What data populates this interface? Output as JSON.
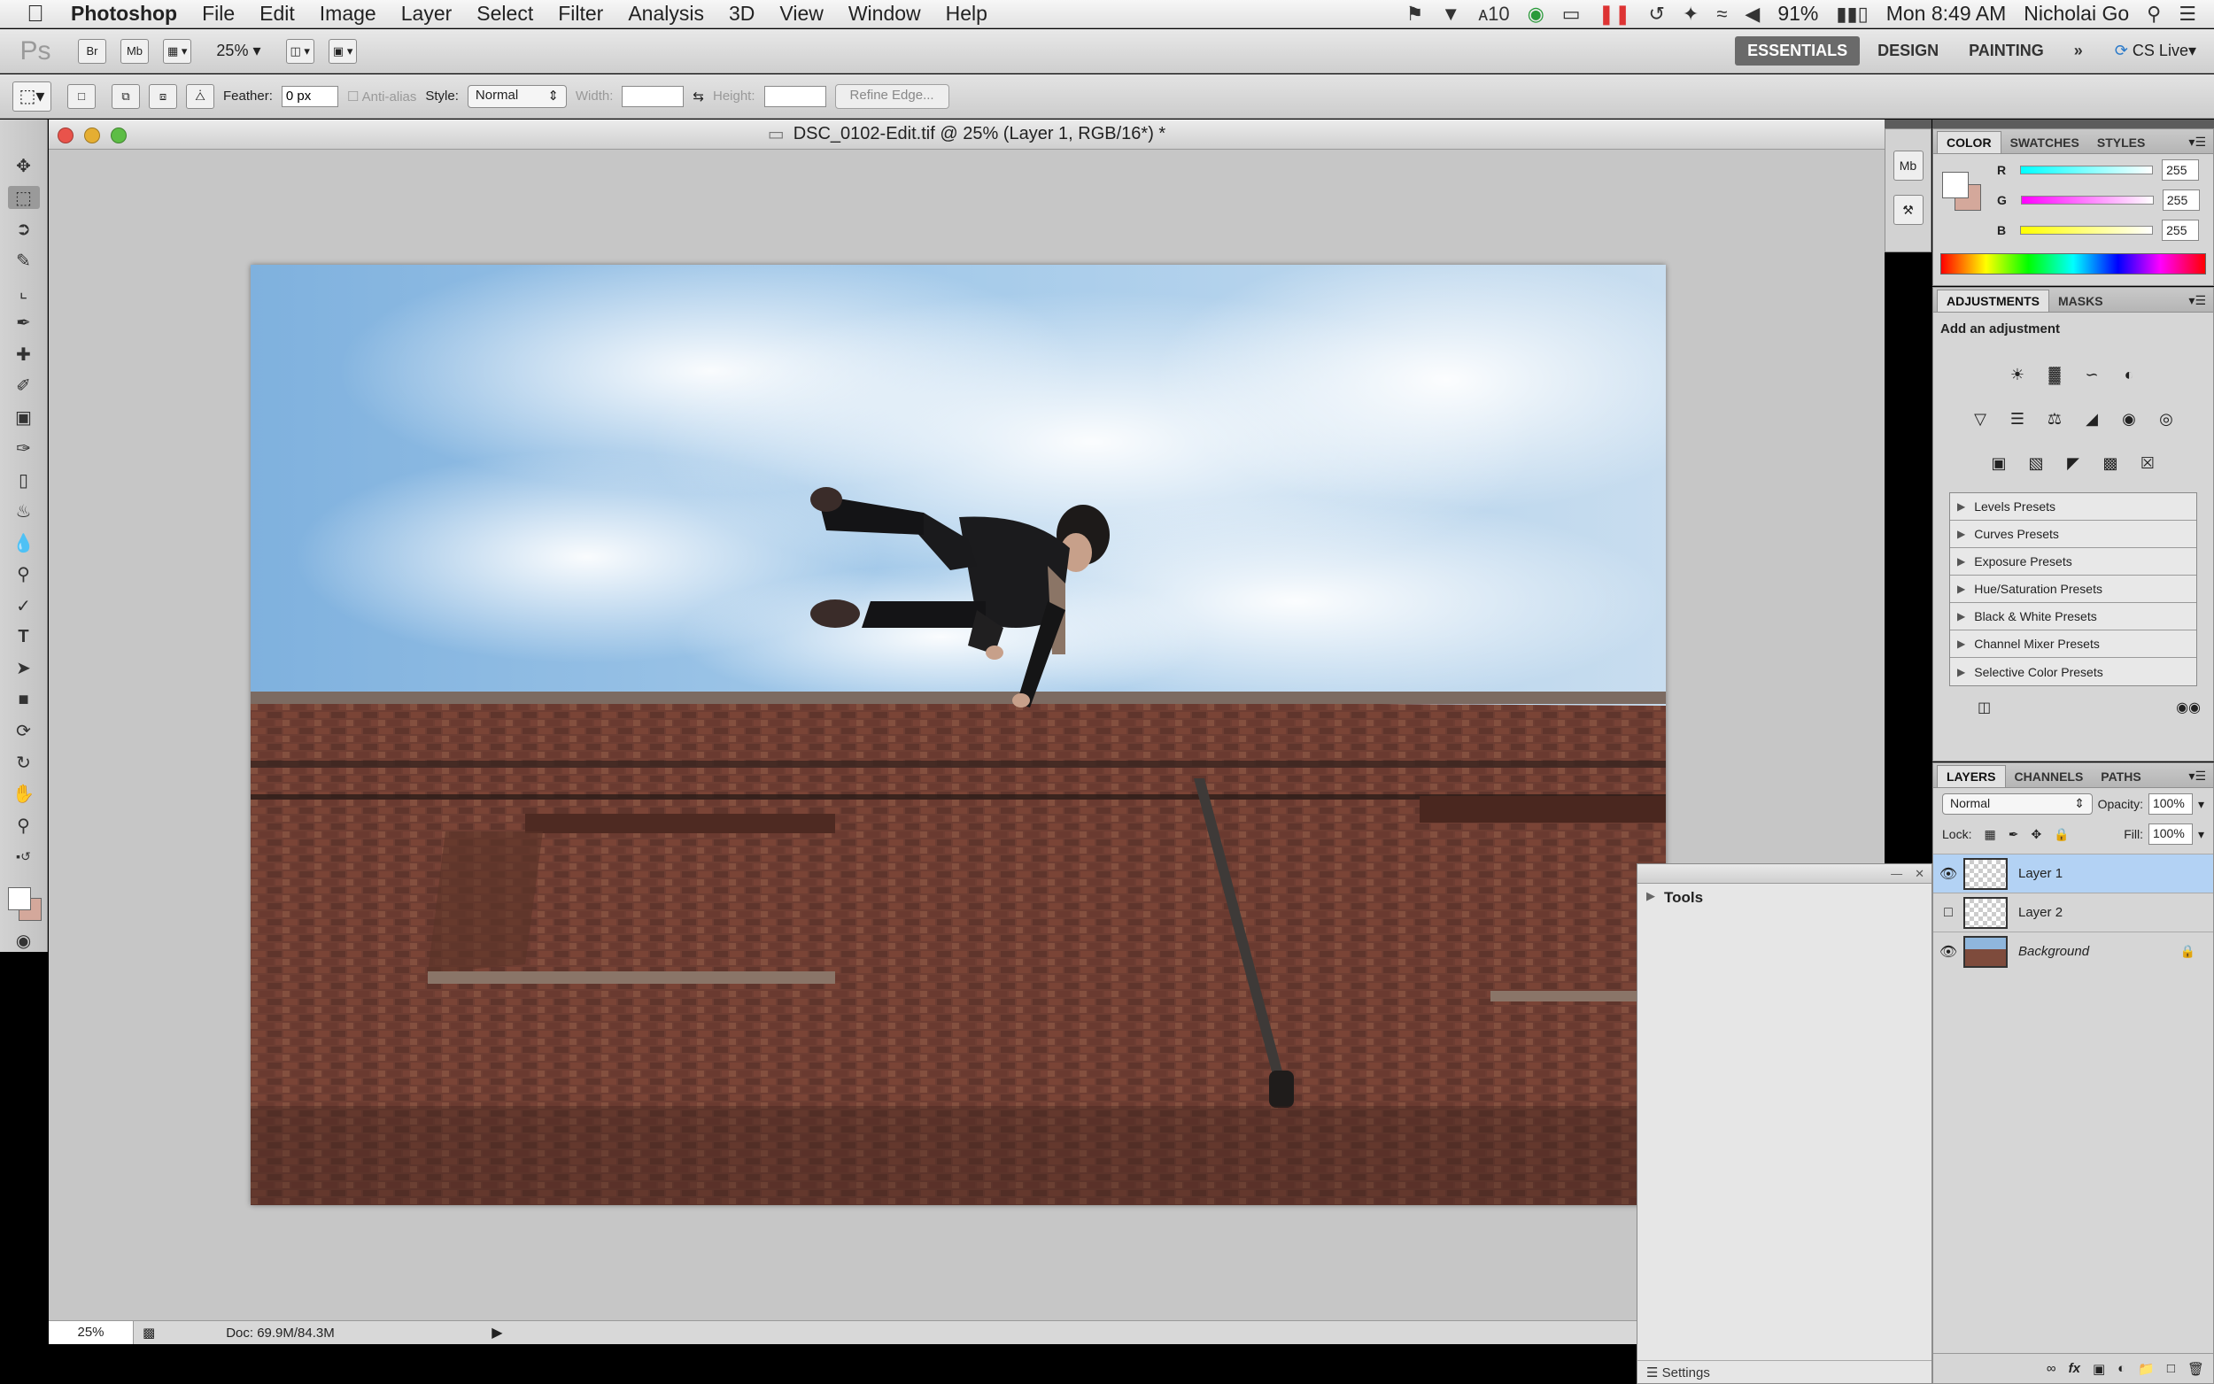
{
  "menubar": {
    "app_name": "Photoshop",
    "menus": [
      "File",
      "Edit",
      "Image",
      "Layer",
      "Select",
      "Filter",
      "Analysis",
      "3D",
      "View",
      "Window",
      "Help"
    ],
    "adobe_count": "10",
    "battery": "91%",
    "clock": "Mon 8:49 AM",
    "user": "Nicholai Go"
  },
  "appbar": {
    "ps_logo": "Ps",
    "bridge": "Br",
    "mini_bridge": "Mb",
    "zoom": "25%",
    "workspaces": [
      "ESSENTIALS",
      "DESIGN",
      "PAINTING"
    ],
    "more": "»",
    "cs_live": "CS Live"
  },
  "options": {
    "feather_label": "Feather:",
    "feather_value": "0 px",
    "antialias_label": "Anti-alias",
    "style_label": "Style:",
    "style_value": "Normal",
    "width_label": "Width:",
    "height_label": "Height:",
    "refine_edge": "Refine Edge..."
  },
  "document": {
    "title": "DSC_0102-Edit.tif @ 25% (Layer 1, RGB/16*) *",
    "zoom": "25%",
    "doc_info": "Doc: 69.9M/84.3M"
  },
  "strip": {
    "mb": "Mb"
  },
  "color_panel": {
    "tabs": [
      "COLOR",
      "SWATCHES",
      "STYLES"
    ],
    "channels": [
      {
        "label": "R",
        "value": "255",
        "gradient": "linear-gradient(90deg,#00ffff,#ffffff)"
      },
      {
        "label": "G",
        "value": "255",
        "gradient": "linear-gradient(90deg,#ff00ff,#ffffff)"
      },
      {
        "label": "B",
        "value": "255",
        "gradient": "linear-gradient(90deg,#ffff00,#ffffff)"
      }
    ],
    "foreground": "#ffffff",
    "background": "#d4a89b"
  },
  "adjustments": {
    "tabs": [
      "ADJUSTMENTS",
      "MASKS"
    ],
    "title": "Add an adjustment",
    "presets": [
      "Levels Presets",
      "Curves Presets",
      "Exposure Presets",
      "Hue/Saturation Presets",
      "Black & White Presets",
      "Channel Mixer Presets",
      "Selective Color Presets"
    ]
  },
  "layers": {
    "tabs": [
      "LAYERS",
      "CHANNELS",
      "PATHS"
    ],
    "blend_mode": "Normal",
    "opacity_label": "Opacity:",
    "opacity": "100%",
    "lock_label": "Lock:",
    "fill_label": "Fill:",
    "fill": "100%",
    "items": [
      {
        "name": "Layer 1",
        "visible": true,
        "selected": true
      },
      {
        "name": "Layer 2",
        "visible": false,
        "selected": false
      },
      {
        "name": "Background",
        "visible": true,
        "selected": false
      }
    ]
  },
  "tools_panel": {
    "title": "Tools",
    "footer": "Settings"
  }
}
